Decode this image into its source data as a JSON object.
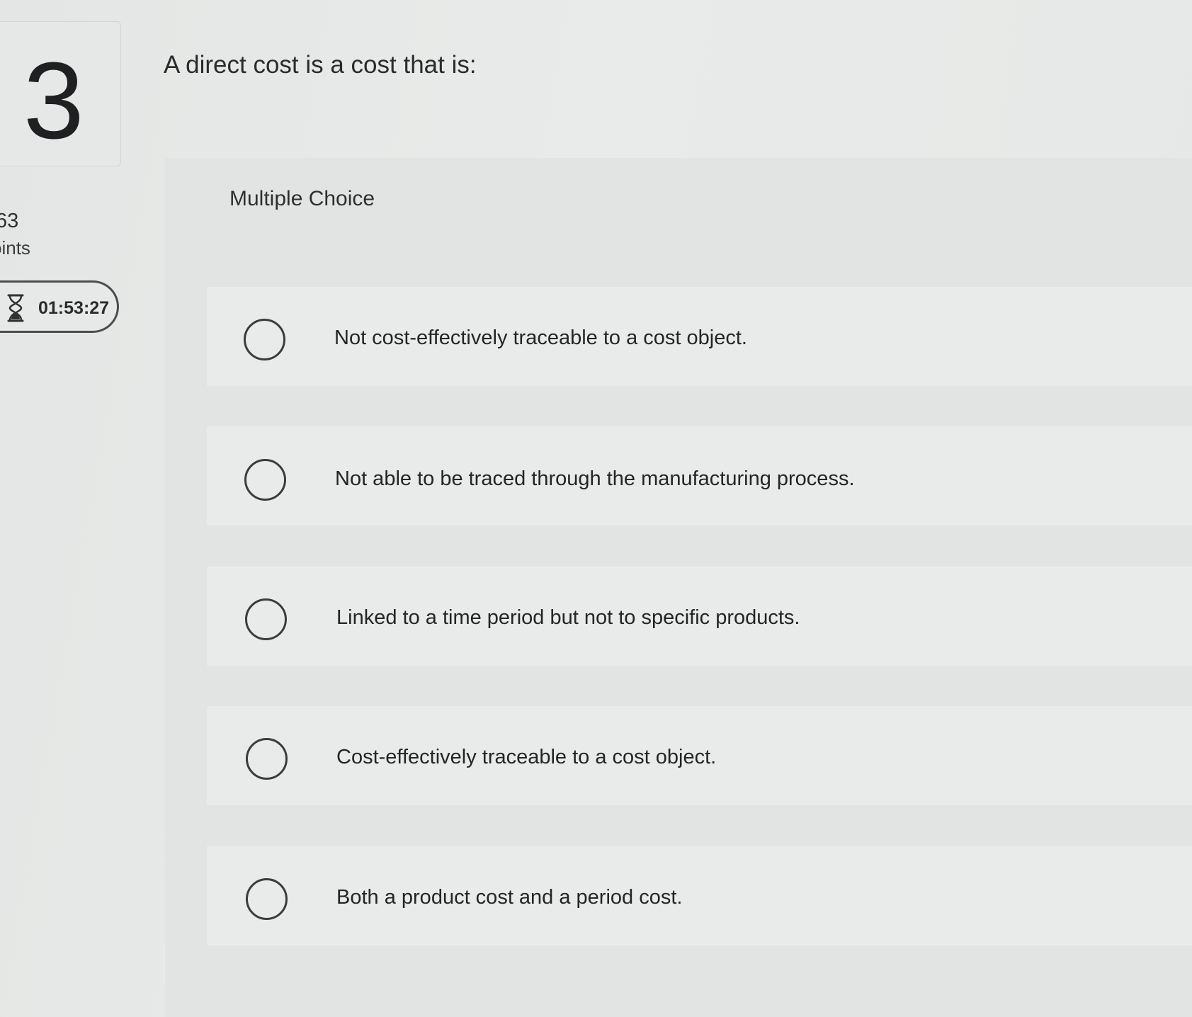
{
  "question": {
    "number": "3",
    "points_value": ".63",
    "points_label": "oints",
    "timer": "01:53:27",
    "timer_icon": "hourglass-icon",
    "prompt": "A direct cost is a cost that is:",
    "type_label": "Multiple Choice"
  },
  "options": [
    {
      "label": "Not cost-effectively traceable to a cost object."
    },
    {
      "label": "Not able to be traced through the manufacturing process."
    },
    {
      "label": "Linked to a time period but not to specific products."
    },
    {
      "label": "Cost-effectively traceable to a cost object."
    },
    {
      "label": "Both a product cost and a period cost."
    }
  ]
}
